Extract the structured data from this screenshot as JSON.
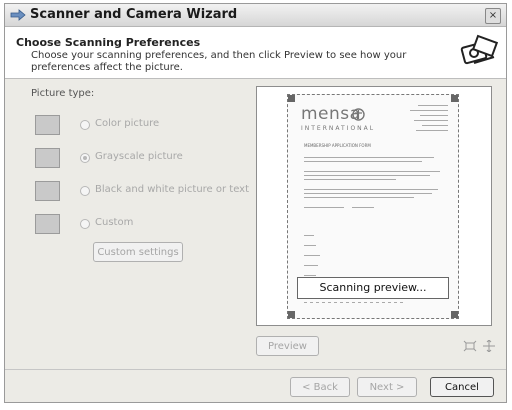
{
  "window": {
    "title": "Scanner and Camera Wizard",
    "close_glyph": "×"
  },
  "header": {
    "title": "Choose Scanning Preferences",
    "description": "Choose your scanning preferences, and then click Preview to see how your preferences affect the picture.",
    "icon": "scanner-camera-icon"
  },
  "picture_type": {
    "label": "Picture type:",
    "options": [
      {
        "label": "Color picture",
        "icon": "color-picture-icon",
        "selected": false
      },
      {
        "label": "Grayscale picture",
        "icon": "grayscale-picture-icon",
        "selected": true
      },
      {
        "label": "Black and white picture or text",
        "icon": "bw-text-icon",
        "selected": false
      },
      {
        "label": "Custom",
        "icon": "custom-icon",
        "selected": false
      }
    ],
    "custom_settings_label": "Custom settings"
  },
  "preview": {
    "document": {
      "logo_text": "mensa",
      "logo_subtitle": "INTERNATIONAL",
      "form_title": "MEMBERSHIP APPLICATION FORM",
      "status_overlay": "Scanning preview..."
    },
    "preview_button_label": "Preview"
  },
  "footer": {
    "back_label": "< Back",
    "next_label": "Next >",
    "cancel_label": "Cancel"
  }
}
